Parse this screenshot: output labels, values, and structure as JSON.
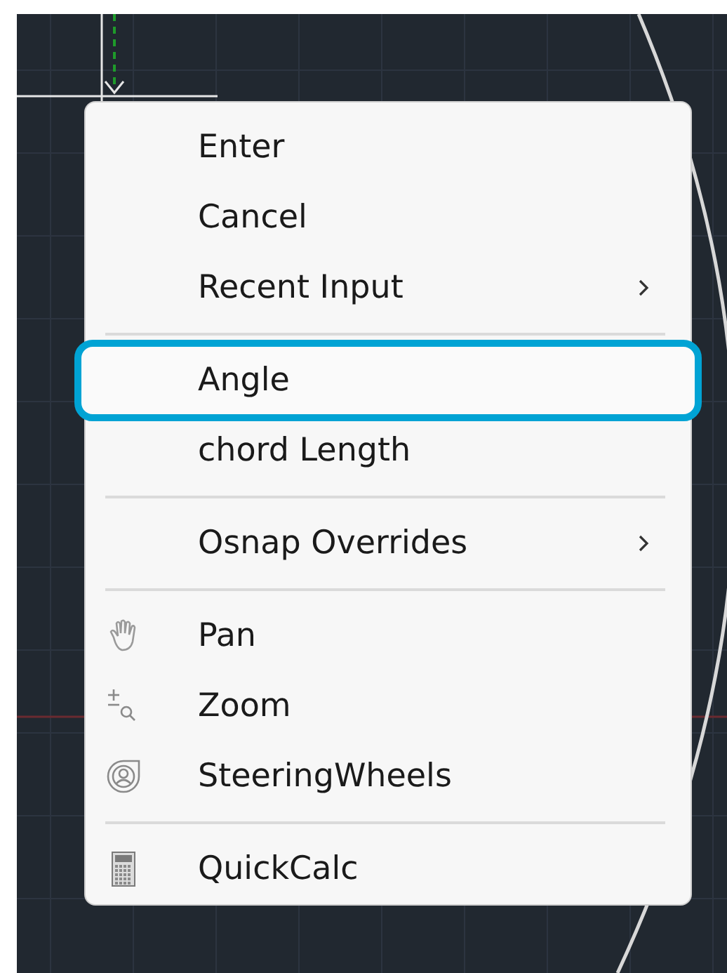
{
  "context_menu": {
    "groups": [
      {
        "items": [
          {
            "label": "Enter",
            "kind": "text",
            "submenu": false,
            "selected": false
          },
          {
            "label": "Cancel",
            "kind": "text",
            "submenu": false,
            "selected": false
          },
          {
            "label": "Recent Input",
            "kind": "text",
            "submenu": true,
            "selected": false
          }
        ]
      },
      {
        "items": [
          {
            "label": "Angle",
            "kind": "text",
            "submenu": false,
            "selected": true
          },
          {
            "label": "chord Length",
            "kind": "text",
            "submenu": false,
            "selected": false
          }
        ]
      },
      {
        "items": [
          {
            "label": "Osnap Overrides",
            "kind": "text",
            "submenu": true,
            "selected": false
          }
        ]
      },
      {
        "items": [
          {
            "label": "Pan",
            "kind": "hand",
            "submenu": false,
            "selected": false
          },
          {
            "label": "Zoom",
            "kind": "zoom",
            "submenu": false,
            "selected": false
          },
          {
            "label": "SteeringWheels",
            "kind": "wheel",
            "submenu": false,
            "selected": false
          }
        ]
      },
      {
        "items": [
          {
            "label": "QuickCalc",
            "kind": "calc",
            "submenu": false,
            "selected": false
          }
        ]
      }
    ]
  }
}
